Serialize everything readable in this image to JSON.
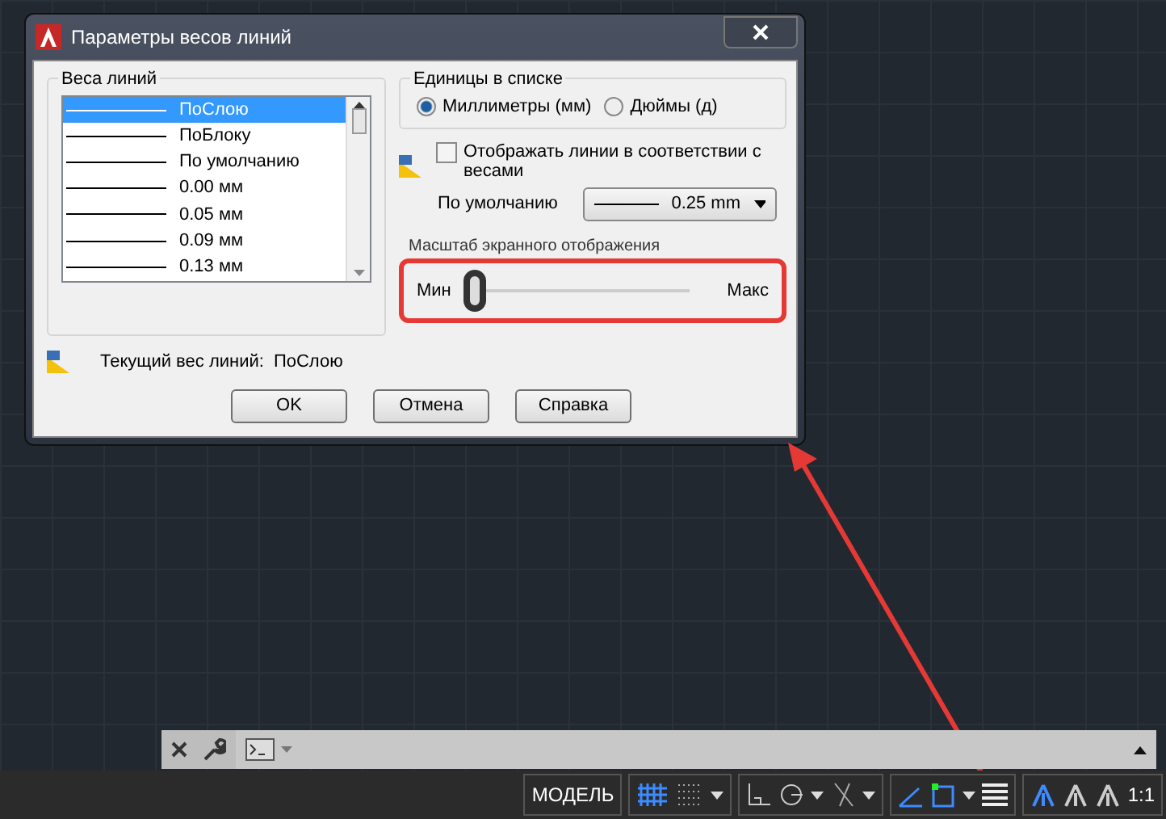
{
  "window": {
    "title": "Параметры весов линий"
  },
  "lineweights": {
    "title": "Веса линий",
    "items": [
      {
        "label": "ПоСлою",
        "selected": true
      },
      {
        "label": "ПоБлоку",
        "selected": false
      },
      {
        "label": "По умолчанию",
        "selected": false
      },
      {
        "label": "0.00 мм",
        "selected": false
      },
      {
        "label": "0.05 мм",
        "selected": false
      },
      {
        "label": "0.09 мм",
        "selected": false
      },
      {
        "label": "0.13 мм",
        "selected": false
      }
    ]
  },
  "units": {
    "title": "Единицы в списке",
    "options": [
      {
        "label": "Миллиметры (мм)",
        "selected": true
      },
      {
        "label": "Дюймы (д)",
        "selected": false
      }
    ]
  },
  "display": {
    "label": "Отображать линии в соответствии с весами",
    "checked": false
  },
  "default": {
    "label": "По умолчанию",
    "value": "0.25 mm"
  },
  "scale": {
    "title": "Масштаб экранного отображения",
    "min": "Мин",
    "max": "Макс",
    "level": 0
  },
  "current": {
    "label": "Текущий вес линий:",
    "value": "ПоСлою"
  },
  "buttons": [
    "OK",
    "Отмена",
    "Справка"
  ],
  "status_bar": {
    "model": "МОДЕЛЬ",
    "scale": "1:1"
  }
}
